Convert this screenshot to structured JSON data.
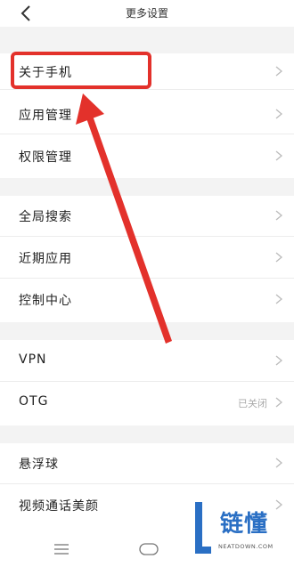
{
  "header": {
    "title": "更多设置"
  },
  "groups": [
    [
      {
        "label": "关于手机"
      },
      {
        "label": "应用管理"
      },
      {
        "label": "权限管理"
      }
    ],
    [
      {
        "label": "全局搜索"
      },
      {
        "label": "近期应用"
      },
      {
        "label": "控制中心"
      }
    ],
    [
      {
        "label": "VPN"
      },
      {
        "label": "OTG",
        "value": "已关闭"
      }
    ],
    [
      {
        "label": "悬浮球"
      },
      {
        "label": "视频通话美颜"
      }
    ]
  ],
  "annotation": {
    "color": "#e3312b"
  },
  "watermark": {
    "logo": "L",
    "text": "链懂",
    "sub": "NEATDOWN.COM",
    "color": "#2a6fc4"
  },
  "icons": {
    "back": "chevron-left-icon",
    "row": "chevron-right-icon",
    "nav": [
      "menu-icon",
      "home-icon"
    ]
  }
}
